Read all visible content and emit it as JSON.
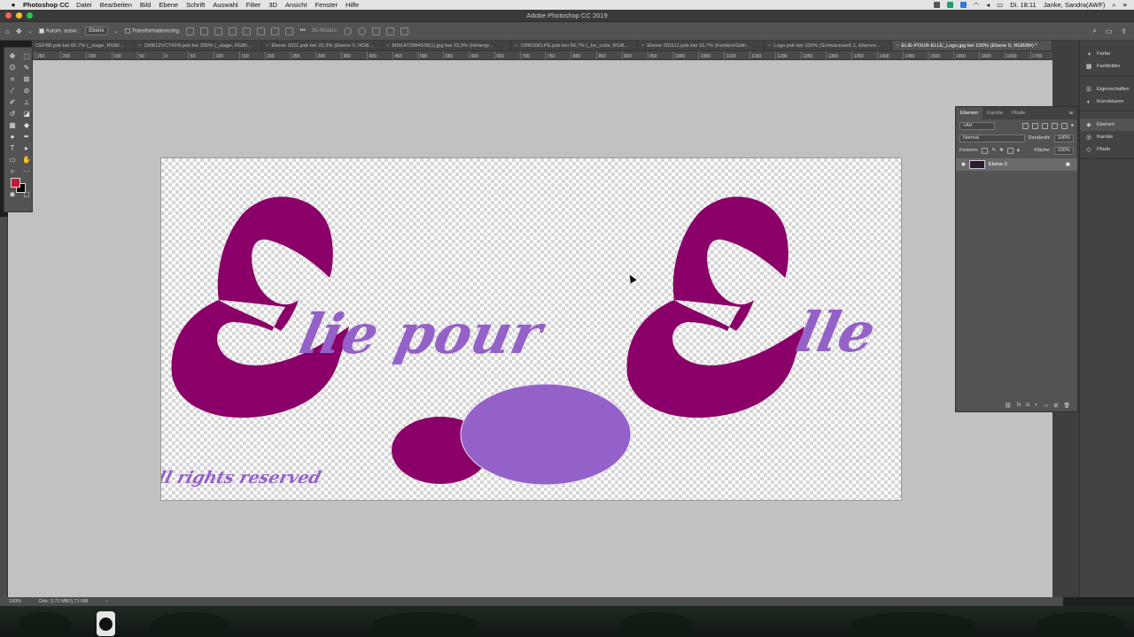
{
  "menubar": {
    "app": "Photoshop CC",
    "items": [
      "Datei",
      "Bearbeiten",
      "Bild",
      "Ebene",
      "Schrift",
      "Auswahl",
      "Filter",
      "3D",
      "Ansicht",
      "Fenster",
      "Hilfe"
    ],
    "clock": "Di. 18:11",
    "user": "Janke, Sandra(AWF)"
  },
  "window": {
    "title": "Adobe Photoshop CC 2019"
  },
  "options": {
    "auto_select_label": "Autom. ausw.:",
    "auto_select_value": "Ebene",
    "transform_label": "Transformationsstrg.",
    "mode_3d_label": "3D-Modus:"
  },
  "tabs": [
    "CEF88.psb bei 66,7% (_stage, RGB/...",
    "190612VCTKF8.psb bei 200% (_stage, RGB/...",
    "Ebene 0311.psb bei 33,3% (Ebene 0, RGB...",
    "8691472584628(1).jpg bei 33,3% (Hintergr...",
    "190616KLPE.psb bei 66,7% (_bn_color, RGB...",
    "Ebene 031111.psb bei 16,7% (Farbton/Sätti...",
    "Logo.psb bei 100% (Schwarzweiß 1, Ebenen...",
    "ELIE-POUR-ELLE_Logo.jpg bei 100% (Ebene 0, RGB/8#) *"
  ],
  "active_tab_index": 7,
  "ruler_ticks": [
    "250",
    "200",
    "150",
    "100",
    "50",
    "0",
    "50",
    "100",
    "150",
    "200",
    "250",
    "300",
    "350",
    "400",
    "450",
    "500",
    "550",
    "600",
    "650",
    "700",
    "750",
    "800",
    "850",
    "900",
    "950",
    "1000",
    "1050",
    "1100",
    "1150",
    "1200",
    "1250",
    "1300",
    "1350",
    "1400",
    "1450",
    "1500",
    "1550",
    "1600",
    "1650",
    "1700"
  ],
  "canvas": {
    "main_text": "lie pour",
    "right_text": "lle",
    "footer_text": "all rights reserved"
  },
  "colors": {
    "dark_purple": "#8a0068",
    "light_purple": "#9461c8",
    "foreground": "#c21a32",
    "background": "#000000"
  },
  "status": {
    "zoom": "100%",
    "doc_info": "Dok: 3,71 MB/3,71 MB"
  },
  "right_panels": {
    "group1": [
      "Farbe",
      "Farbfelder"
    ],
    "group2": [
      "Eigenschaften",
      "Korrekturen"
    ],
    "group3": [
      "Ebenen",
      "Kanäle",
      "Pfade"
    ]
  },
  "layers_panel": {
    "tabs": [
      "Ebenen",
      "Kanäle",
      "Pfade"
    ],
    "filter_kind": "Art",
    "blend_mode": "Normal",
    "opacity_label": "Deckkraft:",
    "opacity_value": "100%",
    "lock_label": "Fixieren:",
    "fill_label": "Fläche:",
    "fill_value": "100%",
    "layers": [
      {
        "name": "Ebene 0"
      }
    ]
  }
}
